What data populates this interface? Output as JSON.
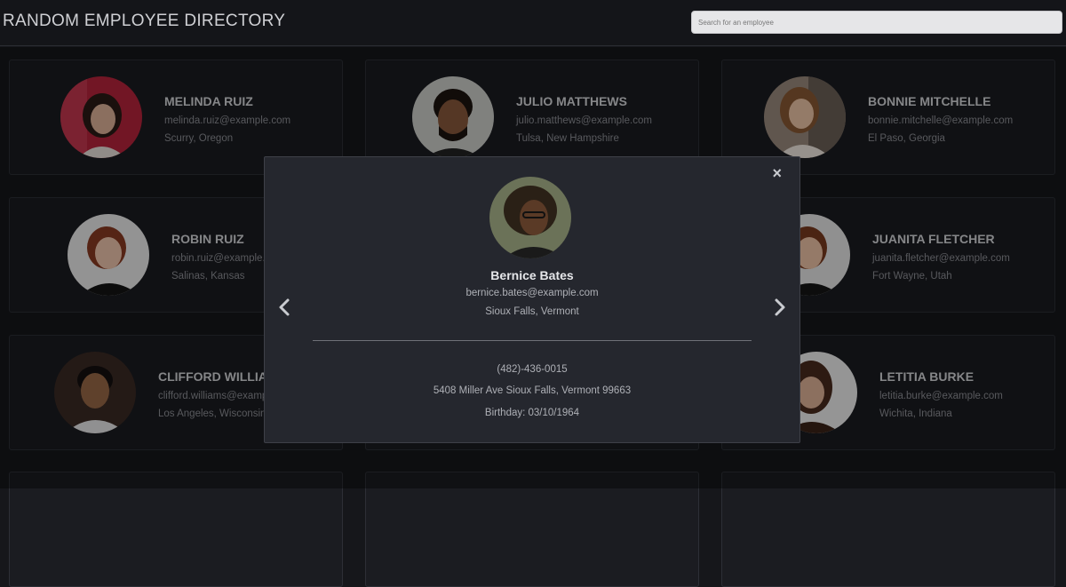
{
  "header": {
    "title": "RANDOM EMPLOYEE DIRECTORY",
    "search_placeholder": "Search for an employee"
  },
  "employees": [
    {
      "name": "MELINDA RUIZ",
      "email": "melinda.ruiz@example.com",
      "location": "Scurry, Oregon"
    },
    {
      "name": "JULIO MATTHEWS",
      "email": "julio.matthews@example.com",
      "location": "Tulsa, New Hampshire"
    },
    {
      "name": "BONNIE MITCHELLE",
      "email": "bonnie.mitchelle@example.com",
      "location": "El Paso, Georgia"
    },
    {
      "name": "ROBIN RUIZ",
      "email": "robin.ruiz@example.com",
      "location": "Salinas, Kansas"
    },
    {
      "name": "",
      "email": "",
      "location": ""
    },
    {
      "name": "JUANITA FLETCHER",
      "email": "juanita.fletcher@example.com",
      "location": "Fort Wayne, Utah"
    },
    {
      "name": "CLIFFORD WILLIAMS",
      "email": "clifford.williams@example.com",
      "location": "Los Angeles, Wisconsin"
    },
    {
      "name": "",
      "email": "",
      "location": ""
    },
    {
      "name": "LETITIA BURKE",
      "email": "letitia.burke@example.com",
      "location": "Wichita, Indiana"
    }
  ],
  "modal": {
    "close_icon": "×",
    "name": "Bernice Bates",
    "email": "bernice.bates@example.com",
    "location": "Sioux Falls, Vermont",
    "phone": "(482)-436-0015",
    "address": "5408 Miller Ave Sioux Falls, Vermont 99663",
    "birthday": "Birthday: 03/10/1964"
  },
  "icons": {
    "close": "close-icon",
    "prev": "chevron-left-icon",
    "next": "chevron-right-icon"
  },
  "colors": {
    "background": "#16171b",
    "card": "#1b1c21",
    "modal": "#25272e"
  }
}
